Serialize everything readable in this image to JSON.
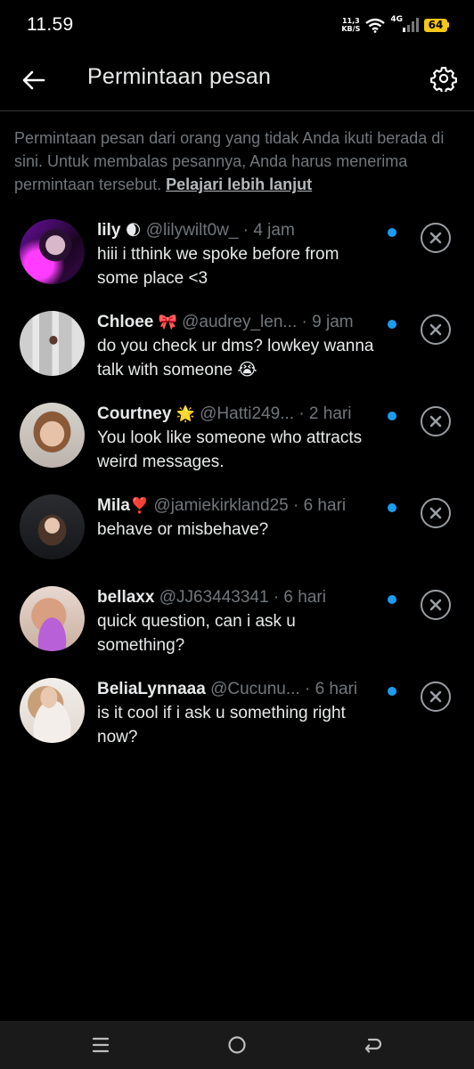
{
  "status_bar": {
    "time": "11.59",
    "net_speed_value": "11,3",
    "net_speed_unit": "KB/S",
    "network_type": "4G",
    "battery_level": "64"
  },
  "header": {
    "title": "Permintaan pesan",
    "back_icon": "arrow-left-icon",
    "settings_icon": "gear-icon"
  },
  "info": {
    "text": "Permintaan pesan dari orang yang tidak Anda ikuti berada di sini. Untuk membalas pesannya, Anda harus menerima permintaan tersebut.",
    "link": "Pelajari lebih lanjut"
  },
  "requests": [
    {
      "name": "lily",
      "emoji": "🌒",
      "handle": "@lilywilt0w_",
      "time": "· 4 jam",
      "message": "hiii i tthink we spoke before from some place <3",
      "unread": true
    },
    {
      "name": "Chloee",
      "emoji": "🎀",
      "handle": "@audrey_len...",
      "time": "· 9 jam",
      "message": "do you check ur dms? lowkey wanna talk with someone 😭",
      "unread": true
    },
    {
      "name": "Courtney",
      "emoji": "🌟",
      "handle": "@Hatti249...",
      "time": "· 2 hari",
      "message": "You look like someone who attracts weird messages.",
      "unread": true
    },
    {
      "name": "Mila",
      "emoji": "❣️",
      "handle": "@jamiekirkland25",
      "time": "· 6 hari",
      "message": "behave or misbehave?",
      "unread": true
    },
    {
      "name": "bellaxx",
      "emoji": "",
      "handle": "@JJ63443341",
      "time": "· 6 hari",
      "message": "quick question, can i ask u something?",
      "unread": true
    },
    {
      "name": "BeliaLynnaaa",
      "emoji": "",
      "handle": "@Cucunu...",
      "time": "· 6 hari",
      "message": "is it cool if i ask u something right now?",
      "unread": true
    }
  ],
  "nav": {
    "recents_icon": "recents-icon",
    "home_icon": "home-icon",
    "back_icon": "back-icon"
  },
  "colors": {
    "background": "#000000",
    "text": "#e7e9ea",
    "muted": "#71767b",
    "unread_dot": "#1d9bf0",
    "divider": "#2f3336"
  }
}
